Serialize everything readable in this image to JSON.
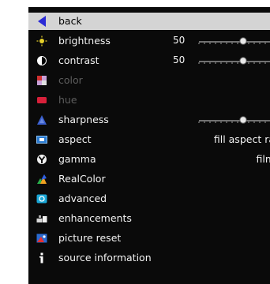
{
  "menu": {
    "items": [
      {
        "label": "back",
        "icon": "back-arrow-icon",
        "selected": true
      },
      {
        "label": "brightness",
        "icon": "sun-icon",
        "value": "50",
        "slider_level": 0.5
      },
      {
        "label": "contrast",
        "icon": "contrast-icon",
        "value": "50",
        "slider_level": 0.5
      },
      {
        "label": "color",
        "icon": "color-palette-icon",
        "disabled": true
      },
      {
        "label": "hue",
        "icon": "hue-icon",
        "disabled": true
      },
      {
        "label": "sharpness",
        "icon": "sharpness-icon",
        "slider_level": 0.5
      },
      {
        "label": "aspect",
        "icon": "aspect-icon",
        "value_text": "fill aspect ra"
      },
      {
        "label": "gamma",
        "icon": "gamma-icon",
        "value_text": "film"
      },
      {
        "label": "RealColor",
        "icon": "realcolor-icon"
      },
      {
        "label": "advanced",
        "icon": "advanced-icon"
      },
      {
        "label": "enhancements",
        "icon": "enhancements-icon"
      },
      {
        "label": "picture reset",
        "icon": "picture-reset-icon"
      },
      {
        "label": "source information",
        "icon": "info-icon"
      }
    ]
  },
  "colors": {
    "menu_background": "#0a0a0a",
    "selected_row": "#d4d4d4",
    "back_arrow": "#2a2ad6",
    "text": "#f2f2f2",
    "disabled_text": "#5e5e5e"
  }
}
